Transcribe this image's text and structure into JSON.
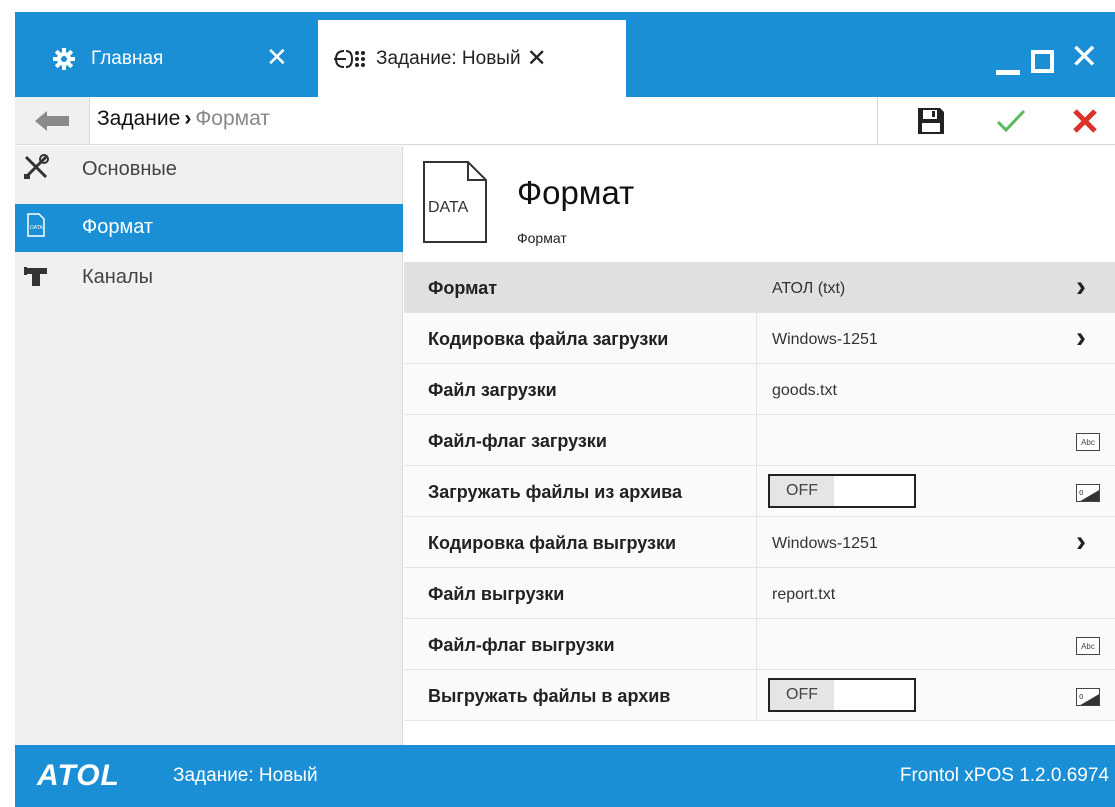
{
  "window": {
    "tabs": [
      {
        "label": "Главная",
        "icon": "gear-icon",
        "close": "✕"
      },
      {
        "label": "Задание: Новый",
        "icon": "exchange-icon",
        "close": "✕"
      }
    ]
  },
  "toolbar": {
    "breadcrumb": {
      "item1": "Задание",
      "separator": "›",
      "item2": "Формат"
    },
    "buttons": [
      "save-icon",
      "confirm-icon",
      "cancel-icon"
    ]
  },
  "sidebar": {
    "items": [
      {
        "label": "Основные",
        "icon": "tools-icon",
        "active": false
      },
      {
        "label": "Формат",
        "icon": "data-file-icon",
        "active": true
      },
      {
        "label": "Каналы",
        "icon": "pipe-icon",
        "active": false
      }
    ]
  },
  "main": {
    "header": {
      "icon_text": "DATA",
      "title": "Формат",
      "subtitle": "Формат"
    },
    "rows": [
      {
        "label": "Формат",
        "value": "АТОЛ (txt)",
        "control": "chevron",
        "selected": true
      },
      {
        "label": "Кодировка файла загрузки",
        "value": "Windows-1251",
        "control": "chevron"
      },
      {
        "label": "Файл загрузки",
        "value": "goods.txt",
        "control": "none"
      },
      {
        "label": "Файл-флаг загрузки",
        "value": "",
        "control": "abc",
        "abc_text": "Abc"
      },
      {
        "label": "Загружать файлы из архива",
        "value": "OFF",
        "control": "toggle"
      },
      {
        "label": "Кодировка файла выгрузки",
        "value": "Windows-1251",
        "control": "chevron"
      },
      {
        "label": "Файл выгрузки",
        "value": "report.txt",
        "control": "none"
      },
      {
        "label": "Файл-флаг выгрузки",
        "value": "",
        "control": "abc",
        "abc_text": "Abc"
      },
      {
        "label": "Выгружать файлы в архив",
        "value": "OFF",
        "control": "toggle"
      }
    ]
  },
  "statusbar": {
    "logo": "ATOL",
    "task": "Задание: Новый",
    "version": "Frontol xPOS 1.2.0.6974"
  },
  "colors": {
    "accent": "#1a8fd5",
    "confirm": "#5cb85c",
    "cancel": "#d9332a"
  }
}
